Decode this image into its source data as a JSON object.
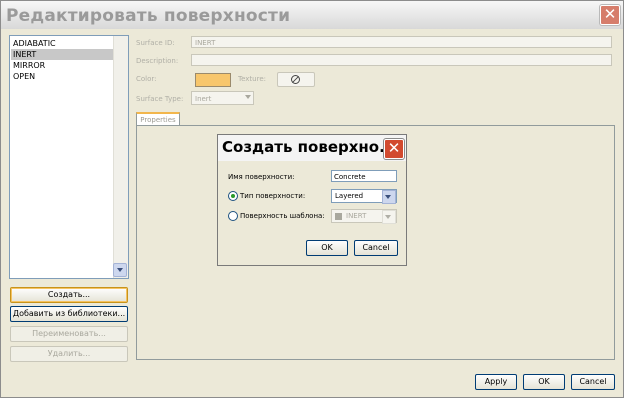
{
  "window": {
    "title": "Редактировать поверхности"
  },
  "surfaces": {
    "items": [
      {
        "label": "ADIABATIC",
        "selected": false
      },
      {
        "label": "INERT",
        "selected": true
      },
      {
        "label": "MIRROR",
        "selected": false
      },
      {
        "label": "OPEN",
        "selected": false
      }
    ]
  },
  "left_buttons": {
    "create": "Создать...",
    "add_from_library": "Добавить из библиотеки...",
    "rename": "Переименовать...",
    "delete": "Удалить..."
  },
  "form": {
    "surface_id_label": "Surface ID:",
    "surface_id_value": "INERT",
    "description_label": "Description:",
    "description_value": "",
    "color_label": "Color:",
    "color_value": "#f7c66c",
    "texture_label": "Texture:",
    "surface_type_label": "Surface Type:",
    "surface_type_value": "Inert",
    "properties_tab": "Properties"
  },
  "dialog": {
    "title": "Создать поверхно...",
    "name_label": "Имя поверхности:",
    "name_value": "Concrete",
    "type_option_label": "Тип поверхности:",
    "type_selected": true,
    "type_value": "Layered",
    "template_option_label": "Поверхность шаблона:",
    "template_selected": false,
    "template_value": "INERT",
    "ok": "OK",
    "cancel": "Cancel"
  },
  "footer": {
    "apply": "Apply",
    "ok": "OK",
    "cancel": "Cancel"
  }
}
